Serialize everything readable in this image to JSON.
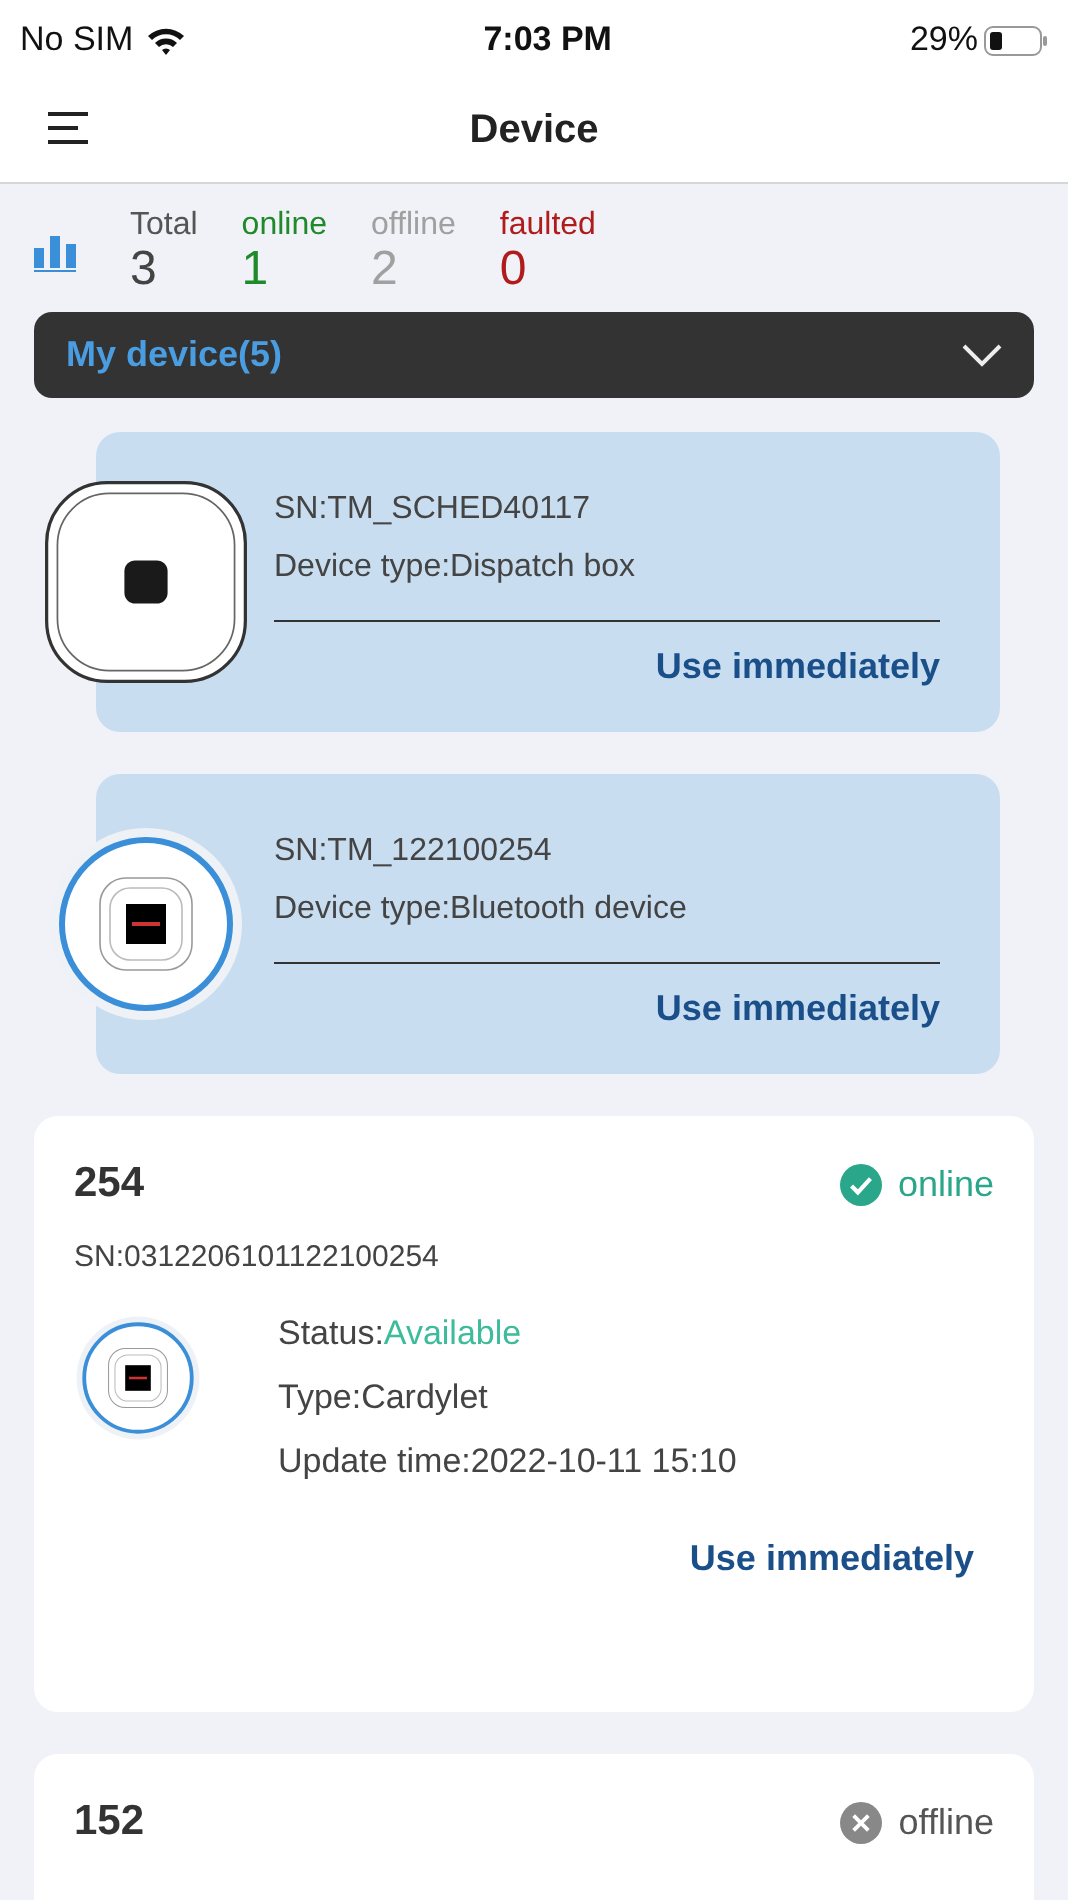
{
  "status_bar": {
    "carrier": "No SIM",
    "time": "7:03 PM",
    "battery": "29%"
  },
  "header": {
    "title": "Device"
  },
  "stats": [
    {
      "label": "Total",
      "value": "3",
      "color": "#444444"
    },
    {
      "label": "online",
      "value": "1",
      "color": "#1f8a2a"
    },
    {
      "label": "offline",
      "value": "2",
      "color": "#a0a0a0"
    },
    {
      "label": "faulted",
      "value": "0",
      "color": "#b01c1c"
    }
  ],
  "dropdown": {
    "label": "My device(5)",
    "expanded": false
  },
  "promo_cards": [
    {
      "kind": "square",
      "sn": "SN:TM_SCHED40117",
      "type": "Device type:Dispatch box",
      "action": "Use immediately"
    },
    {
      "kind": "round",
      "sn": "SN:TM_122100254",
      "type": "Device type:Bluetooth device",
      "action": "Use immediately"
    }
  ],
  "devices": [
    {
      "name": "254",
      "status": "online",
      "online": true,
      "sn": "SN:0312206101122100254",
      "state_label": "Status:",
      "state_value": "Available",
      "type": "Type:Cardylet",
      "update": "Update time:2022-10-11 15:10",
      "action": "Use immediately"
    },
    {
      "name": "152",
      "status": "offline",
      "online": false
    }
  ]
}
